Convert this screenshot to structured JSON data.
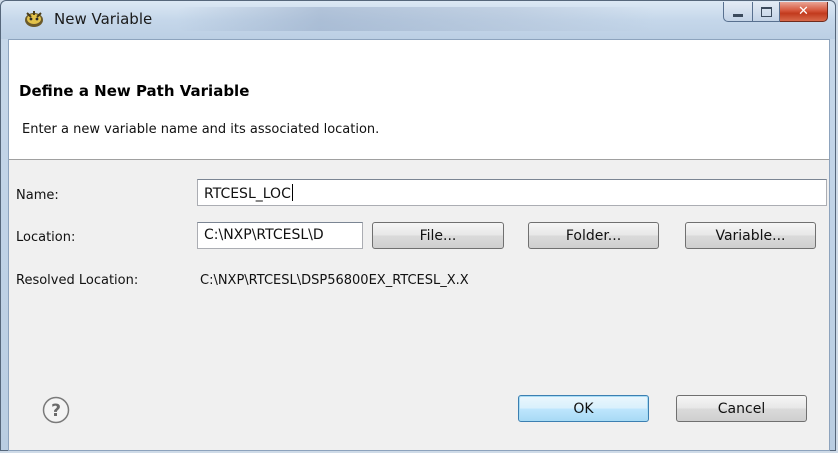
{
  "window": {
    "title": "New Variable",
    "minimize_icon": "minimize-icon",
    "maximize_icon": "maximize-icon",
    "close_icon": "close-icon"
  },
  "header": {
    "title": "Define a New Path Variable",
    "description": "Enter a new variable name and its associated location."
  },
  "form": {
    "name_label": "Name:",
    "name_value": "RTCESL_LOC",
    "location_label": "Location:",
    "location_value": "C:\\NXP\\RTCESL\\D",
    "resolved_label": "Resolved Location:",
    "resolved_value": "C:\\NXP\\RTCESL\\DSP56800EX_RTCESL_X.X"
  },
  "buttons": {
    "file": "File...",
    "folder": "Folder...",
    "variable": "Variable...",
    "ok": "OK",
    "cancel": "Cancel"
  },
  "colors": {
    "accent_default_button": "#3c7fb1",
    "close_button": "#c23a1d"
  }
}
